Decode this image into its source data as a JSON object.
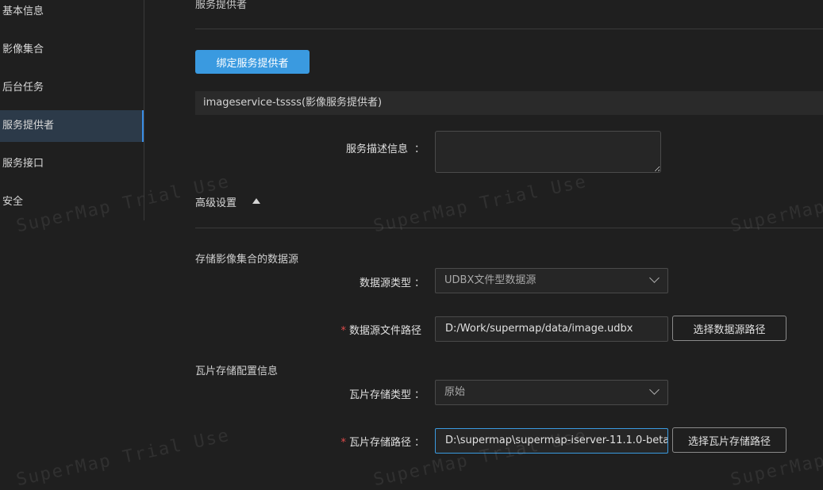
{
  "sidebar": {
    "items": [
      {
        "label": "基本信息"
      },
      {
        "label": "影像集合"
      },
      {
        "label": "后台任务"
      },
      {
        "label": "服务提供者"
      },
      {
        "label": "服务接口"
      },
      {
        "label": "安全"
      }
    ]
  },
  "section_header": "服务提供者",
  "bind_button": "绑定服务提供者",
  "provider_name": "imageservice-tssss(影像服务提供者)",
  "description": {
    "label": "服务描述信息",
    "colon": "：",
    "value": ""
  },
  "advanced": {
    "label": "高级设置"
  },
  "datasource_section": {
    "title": "存储影像集合的数据源",
    "type_label": "数据源类型",
    "type_value": "UDBX文件型数据源",
    "path_label": "数据源文件路径",
    "path_value": "D:/Work/supermap/data/image.udbx",
    "path_button": "选择数据源路径"
  },
  "tile_section": {
    "title": "瓦片存储配置信息",
    "type_label": "瓦片存储类型",
    "type_value": "原始",
    "path_label": "瓦片存储路径",
    "path_value": "D:\\supermap\\supermap-iserver-11.1.0-beta",
    "path_button": "选择瓦片存储路径"
  },
  "required_mark": "*",
  "colon": "：",
  "watermark": "SuperMap Trial Use",
  "colors": {
    "accent": "#3a9ae0",
    "active_bg": "#2c3a49",
    "required": "#e04b4b"
  }
}
